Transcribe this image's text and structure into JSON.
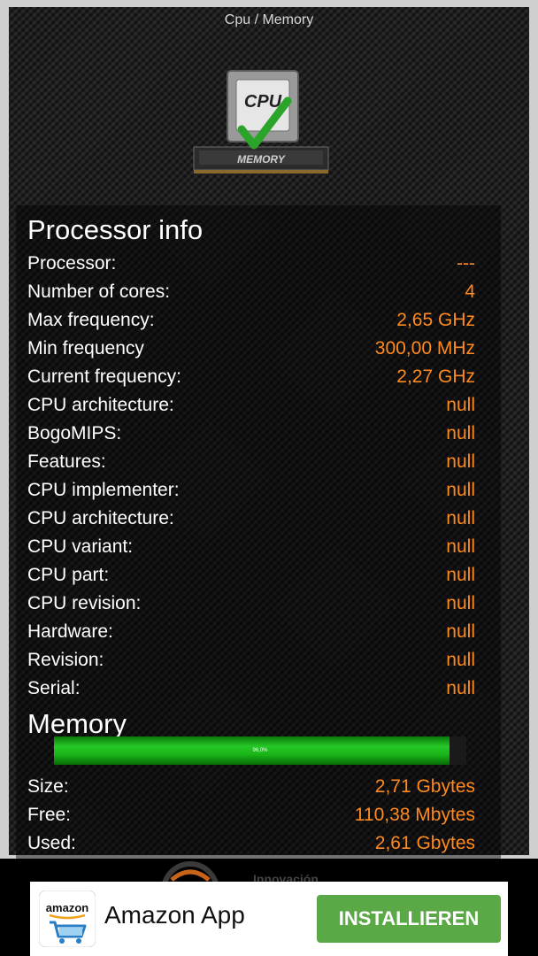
{
  "header": {
    "title": "Cpu / Memory"
  },
  "logo": {
    "cpu_text": "CPU",
    "memory_text": "MEMORY",
    "icon": "cpu-memory-logo-icon"
  },
  "processor": {
    "title": "Processor info",
    "rows": [
      {
        "label": "Processor:",
        "value": "---"
      },
      {
        "label": "Number of cores:",
        "value": "4"
      },
      {
        "label": "Max frequency:",
        "value": "2,65 GHz"
      },
      {
        "label": "Min frequency",
        "value": "300,00 MHz"
      },
      {
        "label": "Current frequency:",
        "value": "2,27 GHz"
      },
      {
        "label": "CPU architecture:",
        "value": "null"
      },
      {
        "label": "BogoMIPS:",
        "value": "null"
      },
      {
        "label": "Features:",
        "value": "null"
      },
      {
        "label": "CPU implementer:",
        "value": "null"
      },
      {
        "label": "CPU architecture:",
        "value": "null"
      },
      {
        "label": "CPU variant:",
        "value": "null"
      },
      {
        "label": "CPU part:",
        "value": "null"
      },
      {
        "label": "CPU revision:",
        "value": "null"
      },
      {
        "label": "Hardware:",
        "value": "null"
      },
      {
        "label": "Revision:",
        "value": "null"
      },
      {
        "label": "Serial:",
        "value": "null"
      }
    ]
  },
  "memory": {
    "title": "Memory",
    "usage_text": "96,0%",
    "usage_fraction": 0.96,
    "rows": [
      {
        "label": "Size:",
        "value": "2,71 Gbytes"
      },
      {
        "label": "Free:",
        "value": "110,38 Mbytes"
      },
      {
        "label": "Used:",
        "value": "2,61 Gbytes"
      }
    ]
  },
  "bottom_banner": {
    "text": "Innovación"
  },
  "ad": {
    "brand": "amazon",
    "title": "Amazon App",
    "button_label": "INSTALLIEREN",
    "button_color": "#5aa846"
  },
  "colors": {
    "value_accent": "#ff8a1f",
    "bar_green": "#18b318"
  }
}
